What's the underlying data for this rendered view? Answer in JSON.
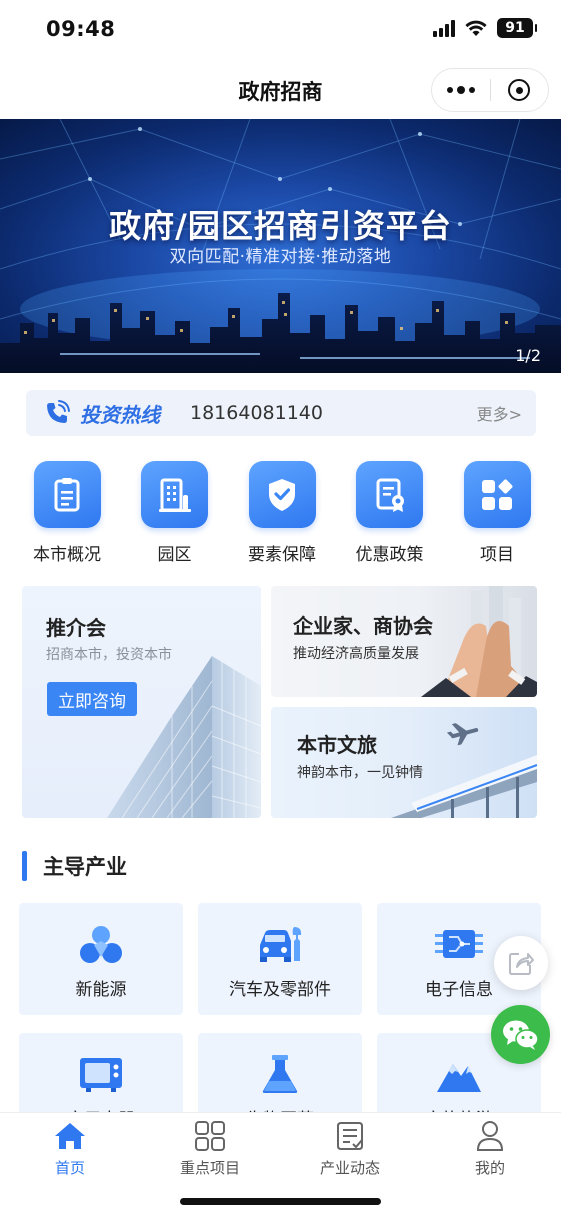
{
  "status_bar": {
    "time": "09:48",
    "battery": "91"
  },
  "nav": {
    "title": "政府招商"
  },
  "banner": {
    "title": "政府/园区招商引资平台",
    "subtitle": "双向匹配·精准对接·推动落地",
    "pager": "1/2"
  },
  "hotline": {
    "label": "投资热线",
    "phone": "18164081140",
    "more": "更多>"
  },
  "quick_links": [
    {
      "label": "本市概况",
      "icon": "document-icon"
    },
    {
      "label": "园区",
      "icon": "building-icon"
    },
    {
      "label": "要素保障",
      "icon": "shield-check-icon"
    },
    {
      "label": "优惠政策",
      "icon": "certificate-icon"
    },
    {
      "label": "项目",
      "icon": "apps-icon"
    }
  ],
  "promos": {
    "left": {
      "title": "推介会",
      "subtitle": "招商本市，投资本市",
      "button": "立即咨询"
    },
    "right_top": {
      "title": "企业家、商协会",
      "subtitle": "推动经济高质量发展"
    },
    "right_bottom": {
      "title": "本市文旅",
      "subtitle": "神韵本市，一见钟情"
    }
  },
  "section": {
    "title": "主导产业"
  },
  "industries": [
    {
      "label": "新能源",
      "icon": "new-energy-icon"
    },
    {
      "label": "汽车及零部件",
      "icon": "car-wrench-icon"
    },
    {
      "label": "电子信息",
      "icon": "chip-icon"
    },
    {
      "label": "家用电器",
      "icon": "appliance-icon"
    },
    {
      "label": "生物医药",
      "icon": "flask-icon"
    },
    {
      "label": "文旅旅游",
      "icon": "mountain-icon"
    }
  ],
  "tabs": [
    {
      "label": "首页",
      "icon": "home-icon",
      "active": true
    },
    {
      "label": "重点项目",
      "icon": "grid-icon",
      "active": false
    },
    {
      "label": "产业动态",
      "icon": "news-icon",
      "active": false
    },
    {
      "label": "我的",
      "icon": "user-icon",
      "active": false
    }
  ],
  "colors": {
    "accent": "#2f78f0",
    "wechat": "#3cbc4a",
    "card_bg": "#eef4fd"
  }
}
